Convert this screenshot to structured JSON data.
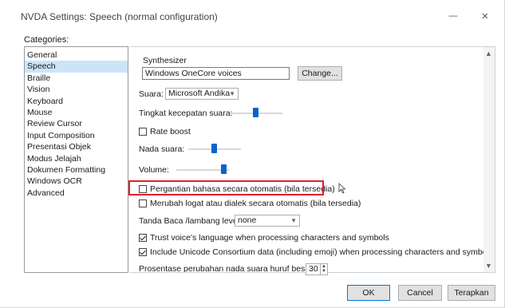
{
  "window": {
    "title": "NVDA Settings: Speech (normal configuration)",
    "minimize_glyph": "—",
    "close_glyph": "✕"
  },
  "categories": {
    "label": "Categories:",
    "items": [
      "General",
      "Speech",
      "Braille",
      "Vision",
      "Keyboard",
      "Mouse",
      "Review Cursor",
      "Input Composition",
      "Presentasi Objek",
      "Modus Jelajah",
      "Dokumen Formatting",
      "Windows OCR",
      "Advanced"
    ],
    "selected_index": 1
  },
  "speech": {
    "synthesizer_group_title": "Synthesizer",
    "synthesizer_value": "Windows OneCore voices",
    "change_button": "Change...",
    "voice_label": "Suara:",
    "voice_value": "Microsoft Andika",
    "rate_label": "Tingkat kecepatan suara:",
    "rate_value": 50,
    "rate_boost_label": "Rate boost",
    "rate_boost_checked": false,
    "pitch_label": "Nada suara:",
    "pitch_value": 50,
    "volume_label": "Volume:",
    "volume_value": 100,
    "auto_language_label": "Pergantian bahasa secara otomatis (bila tersedia)",
    "auto_language_checked": false,
    "auto_dialect_label": "Merubah logat atau dialek secara otomatis (bila tersedia)",
    "auto_dialect_checked": false,
    "punctuation_label": "Tanda Baca /lambang level:",
    "punctuation_value": "none",
    "trust_voice_label": "Trust voice's language when processing characters and symbols",
    "trust_voice_checked": true,
    "unicode_label": "Include Unicode Consortium data (including emoji) when processing characters and symbols",
    "unicode_checked": true,
    "cap_pitch_label": "Prosentase perubahan nada suara huruf besar",
    "cap_pitch_value": "30"
  },
  "footer": {
    "ok": "OK",
    "cancel": "Cancel",
    "apply": "Terapkan"
  },
  "colors": {
    "selection": "#cce4f7",
    "slider_accent": "#0a64c8",
    "highlight_box": "#e0202a"
  }
}
